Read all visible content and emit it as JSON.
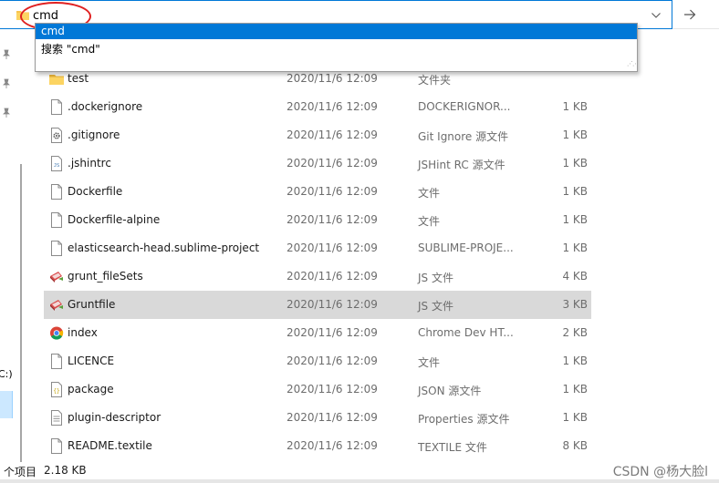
{
  "address_bar": {
    "value": "cmd",
    "dropdown_glyph": "⌵",
    "go_glyph": "→"
  },
  "autocomplete": {
    "highlighted": "cmd",
    "search_suggestion": "搜索 \"cmd\""
  },
  "nav": {
    "drive_label": "C:)"
  },
  "files": [
    {
      "name": "test",
      "date": "2020/11/6 12:09",
      "type": "文件夹",
      "size": "",
      "icon": "folder-icon"
    },
    {
      "name": ".dockerignore",
      "date": "2020/11/6 12:09",
      "type": "DOCKERIGNOR...",
      "size": "1 KB",
      "icon": "file-icon"
    },
    {
      "name": ".gitignore",
      "date": "2020/11/6 12:09",
      "type": "Git Ignore 源文件",
      "size": "1 KB",
      "icon": "gear-file-icon"
    },
    {
      "name": ".jshintrc",
      "date": "2020/11/6 12:09",
      "type": "JSHint RC 源文件",
      "size": "1 KB",
      "icon": "js-file-icon"
    },
    {
      "name": "Dockerfile",
      "date": "2020/11/6 12:09",
      "type": "文件",
      "size": "1 KB",
      "icon": "file-icon"
    },
    {
      "name": "Dockerfile-alpine",
      "date": "2020/11/6 12:09",
      "type": "文件",
      "size": "1 KB",
      "icon": "file-icon"
    },
    {
      "name": "elasticsearch-head.sublime-project",
      "date": "2020/11/6 12:09",
      "type": "SUBLIME-PROJE...",
      "size": "1 KB",
      "icon": "file-icon"
    },
    {
      "name": "grunt_fileSets",
      "date": "2020/11/6 12:09",
      "type": "JS 文件",
      "size": "4 KB",
      "icon": "script-icon"
    },
    {
      "name": "Gruntfile",
      "date": "2020/11/6 12:09",
      "type": "JS 文件",
      "size": "3 KB",
      "icon": "script-icon",
      "selected": true
    },
    {
      "name": "index",
      "date": "2020/11/6 12:09",
      "type": "Chrome Dev HT...",
      "size": "2 KB",
      "icon": "chrome-icon"
    },
    {
      "name": "LICENCE",
      "date": "2020/11/6 12:09",
      "type": "文件",
      "size": "1 KB",
      "icon": "file-icon"
    },
    {
      "name": "package",
      "date": "2020/11/6 12:09",
      "type": "JSON 源文件",
      "size": "1 KB",
      "icon": "json-file-icon"
    },
    {
      "name": "plugin-descriptor",
      "date": "2020/11/6 12:09",
      "type": "Properties 源文件",
      "size": "1 KB",
      "icon": "lines-file-icon"
    },
    {
      "name": "README.textile",
      "date": "2020/11/6 12:09",
      "type": "TEXTILE 文件",
      "size": "8 KB",
      "icon": "file-icon"
    }
  ],
  "status": {
    "item_count": "个项目",
    "size": "2.18 KB",
    "watermark": "CSDN @杨大脸l"
  }
}
